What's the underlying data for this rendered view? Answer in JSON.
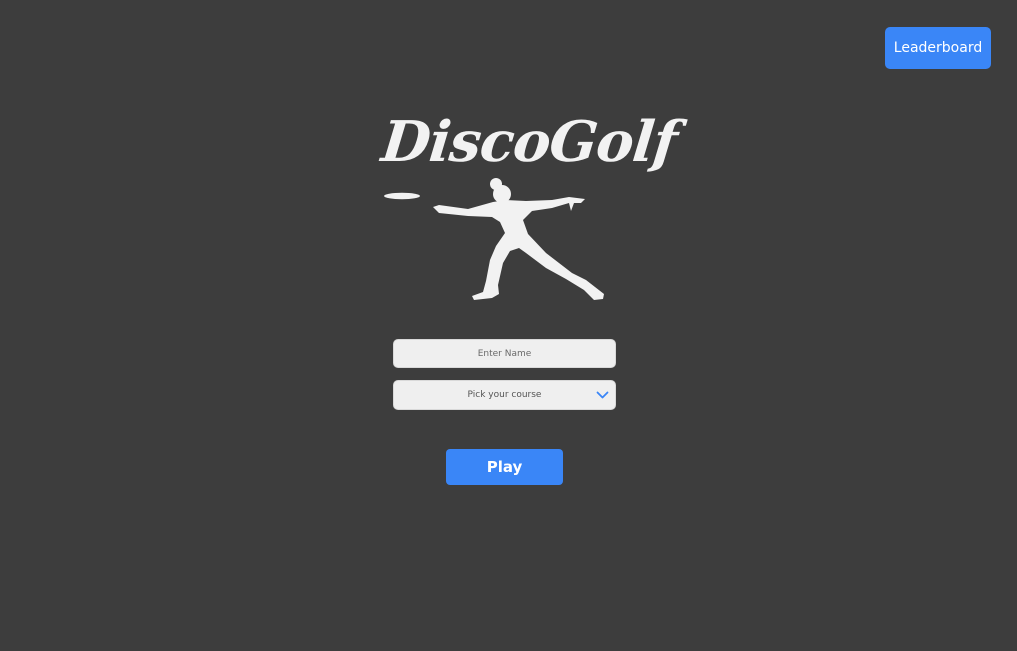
{
  "header": {
    "leaderboard_label": "Leaderboard"
  },
  "logo": {
    "wordmark": "DiscoGolf",
    "color": "#f2f2f2"
  },
  "form": {
    "name_placeholder": "Enter Name",
    "name_value": "",
    "course_selected": "Pick your course"
  },
  "actions": {
    "play_label": "Play"
  },
  "colors": {
    "background": "#3d3d3d",
    "accent": "#3a86f7",
    "field": "#efefef"
  },
  "icons": {
    "dropdown": "chevron-down-icon",
    "figure": "disc-thrower-figure"
  }
}
